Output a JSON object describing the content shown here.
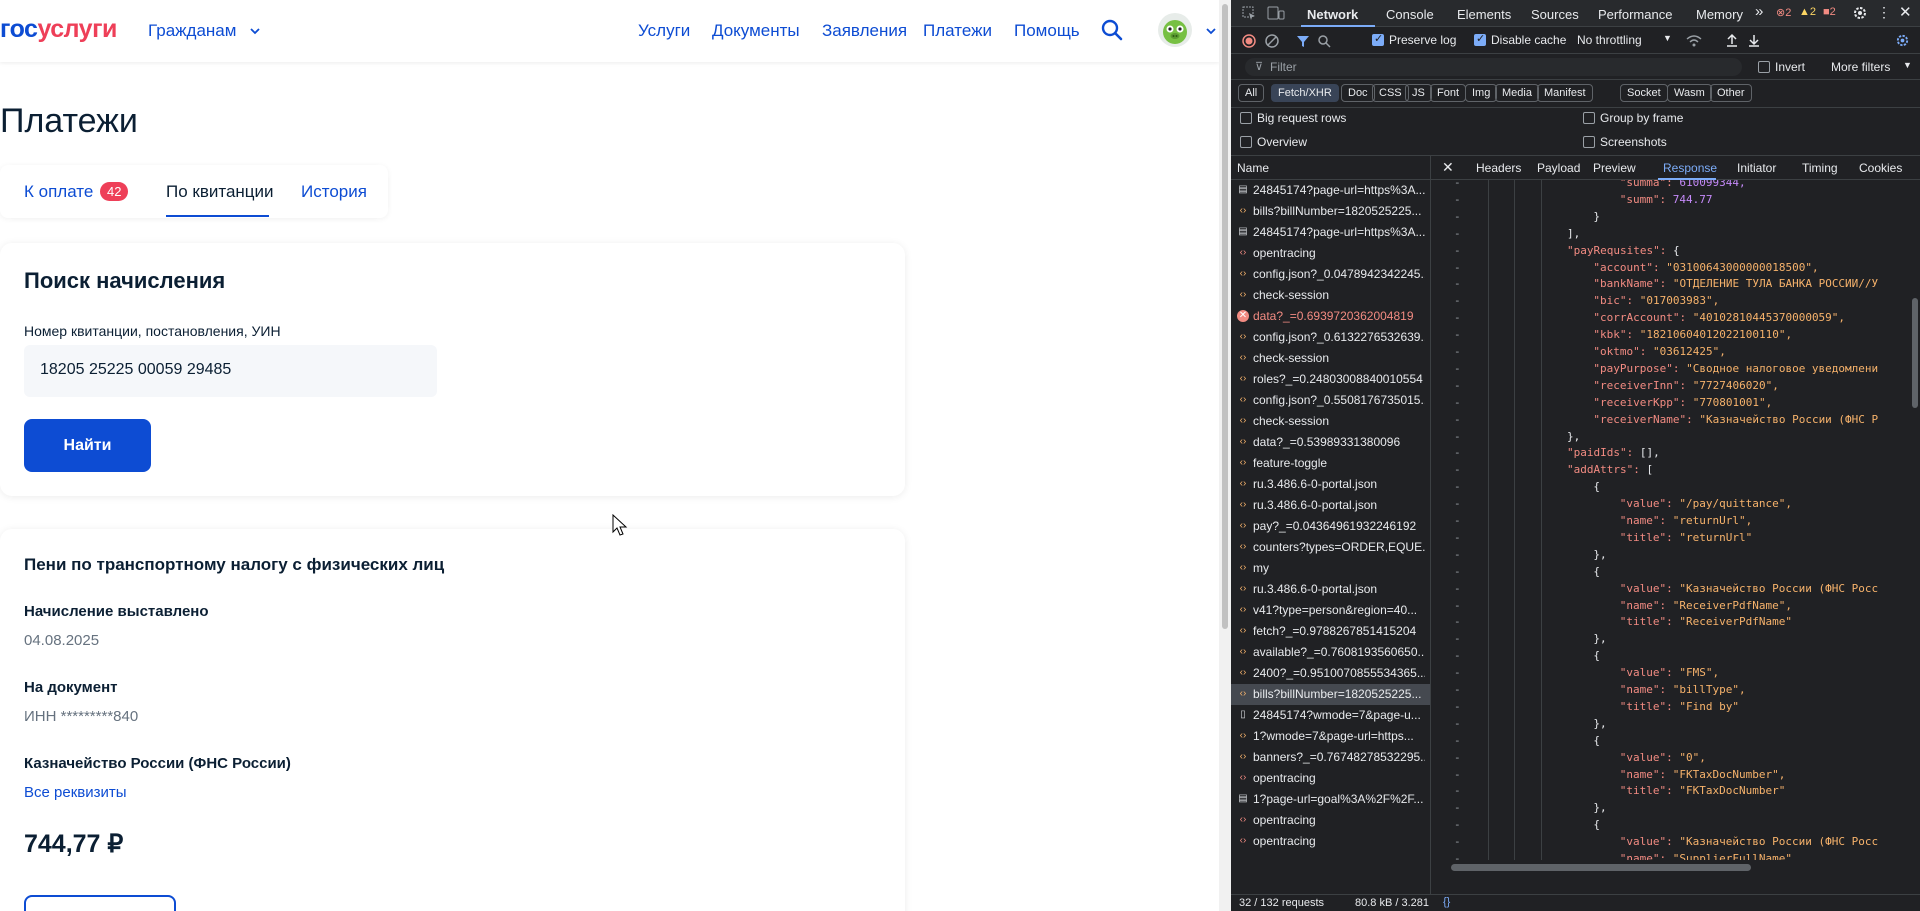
{
  "site": {
    "logo_part1": "гос",
    "logo_part2": "услуги",
    "citizen_menu": "Гражданам",
    "nav": [
      "Услуги",
      "Документы",
      "Заявления",
      "Платежи",
      "Помощь"
    ]
  },
  "page": {
    "title": "Платежи",
    "tabs": [
      {
        "label": "К оплате",
        "badge": "42"
      },
      {
        "label": "По квитанции"
      },
      {
        "label": "История"
      }
    ],
    "active_tab": "По квитанции"
  },
  "search_card": {
    "title": "Поиск начисления",
    "field_label": "Номер квитанции, постановления, УИН",
    "field_value": "18205 25225 00059 29485",
    "button": "Найти"
  },
  "charge_card": {
    "title": "Пени по транспортному налогу с физических лиц",
    "issued_label": "Начисление выставлено",
    "issued_value": "04.08.2025",
    "document_label": "На документ",
    "document_value": "ИНН *********840",
    "receiver": "Казначейство России (ФНС России)",
    "details_link": "Все реквизиты",
    "amount": "744,77 ₽"
  },
  "devtools": {
    "tabs": [
      "Network",
      "Console",
      "Elements",
      "Sources",
      "Performance",
      "Memory"
    ],
    "more_tabs": "»",
    "error_counts": [
      "2",
      "2",
      "2"
    ],
    "toolbar": {
      "preserve_log": "Preserve log",
      "disable_cache": "Disable cache",
      "throttling": "No throttling"
    },
    "filter_placeholder": "Filter",
    "invert": "Invert",
    "more_filters": "More filters",
    "type_filters": [
      "All",
      "Fetch/XHR",
      "Doc",
      "CSS",
      "JS",
      "Font",
      "Img",
      "Media",
      "Manifest",
      "Socket",
      "Wasm",
      "Other"
    ],
    "selected_type": "Fetch/XHR",
    "options": [
      "Big request rows",
      "Group by frame",
      "Overview",
      "Screenshots"
    ],
    "name_header": "Name",
    "requests": [
      {
        "name": "24845174?page-url=https%3A...",
        "icon": "doc"
      },
      {
        "name": "bills?billNumber=1820525225...",
        "icon": "xhr"
      },
      {
        "name": "24845174?page-url=https%3A...",
        "icon": "doc"
      },
      {
        "name": "opentracing",
        "icon": "fetch"
      },
      {
        "name": "config.json?_0.0478942342245...",
        "icon": "xhr"
      },
      {
        "name": "check-session",
        "icon": "xhr"
      },
      {
        "name": "data?_=0.6939720362004819",
        "icon": "error"
      },
      {
        "name": "config.json?_0.6132276532639...",
        "icon": "xhr"
      },
      {
        "name": "check-session",
        "icon": "xhr"
      },
      {
        "name": "roles?_=0.24803008840010554",
        "icon": "xhr"
      },
      {
        "name": "config.json?_0.5508176735015...",
        "icon": "xhr"
      },
      {
        "name": "check-session",
        "icon": "xhr"
      },
      {
        "name": "data?_=0.53989331380096",
        "icon": "xhr"
      },
      {
        "name": "feature-toggle",
        "icon": "xhr"
      },
      {
        "name": "ru.3.486.6-0-portal.json",
        "icon": "xhr"
      },
      {
        "name": "ru.3.486.6-0-portal.json",
        "icon": "xhr"
      },
      {
        "name": "pay?_=0.04364961932246192",
        "icon": "xhr"
      },
      {
        "name": "counters?types=ORDER,EQUE...",
        "icon": "xhr"
      },
      {
        "name": "my",
        "icon": "xhr"
      },
      {
        "name": "ru.3.486.6-0-portal.json",
        "icon": "xhr"
      },
      {
        "name": "v41?type=person&region=40...",
        "icon": "xhr"
      },
      {
        "name": "fetch?_=0.9788267851415204",
        "icon": "xhr"
      },
      {
        "name": "available?_=0.7608193560650...",
        "icon": "xhr"
      },
      {
        "name": "2400?_=0.9510070855534365...",
        "icon": "xhr"
      },
      {
        "name": "bills?billNumber=1820525225...",
        "icon": "xhr",
        "selected": true
      },
      {
        "name": "24845174?wmode=7&page-u...",
        "icon": "file"
      },
      {
        "name": "1?wmode=7&page-url=https...",
        "icon": "xhr"
      },
      {
        "name": "banners?_=0.76748278532295...",
        "icon": "xhr"
      },
      {
        "name": "opentracing",
        "icon": "fetch"
      },
      {
        "name": "1?page-url=goal%3A%2F%2F...",
        "icon": "doc"
      },
      {
        "name": "opentracing",
        "icon": "fetch"
      },
      {
        "name": "opentracing",
        "icon": "fetch"
      }
    ],
    "response_tabs": [
      "Headers",
      "Payload",
      "Preview",
      "Response",
      "Initiator",
      "Timing",
      "Cookies"
    ],
    "selected_response_tab": "Response",
    "response_lines": [
      {
        "indent": 20,
        "text": "\"summa\": 610099344,",
        "color": "kk"
      },
      {
        "indent": 20,
        "text": "\"summ\": 744.77",
        "color": "kk"
      },
      {
        "indent": 16,
        "text": "}",
        "color": ""
      },
      {
        "indent": 12,
        "text": "],",
        "color": ""
      },
      {
        "indent": 12,
        "text": "\"payRequsites\": {",
        "color": "kk"
      },
      {
        "indent": 16,
        "text": "\"account\": \"03100643000000018500\",",
        "color": "kk"
      },
      {
        "indent": 16,
        "text": "\"bankName\": \"ОТДЕЛЕНИЕ ТУЛА БАНКА РОССИИ//У",
        "color": "kk"
      },
      {
        "indent": 16,
        "text": "\"bic\": \"017003983\",",
        "color": "kk"
      },
      {
        "indent": 16,
        "text": "\"corrAccount\": \"40102810445370000059\",",
        "color": "kk"
      },
      {
        "indent": 16,
        "text": "\"kbk\": \"18210604012022100110\",",
        "color": "kk"
      },
      {
        "indent": 16,
        "text": "\"oktmo\": \"03612425\",",
        "color": "kk"
      },
      {
        "indent": 16,
        "text": "\"payPurpose\": \"Сводное налоговое уведомлени",
        "color": "kk"
      },
      {
        "indent": 16,
        "text": "\"receiverInn\": \"7727406020\",",
        "color": "kk"
      },
      {
        "indent": 16,
        "text": "\"receiverKpp\": \"770801001\",",
        "color": "kk"
      },
      {
        "indent": 16,
        "text": "\"receiverName\": \"Казначейство России (ФНС Р",
        "color": "kk"
      },
      {
        "indent": 12,
        "text": "},",
        "color": ""
      },
      {
        "indent": 12,
        "text": "\"paidIds\": [],",
        "color": "kk"
      },
      {
        "indent": 12,
        "text": "\"addAttrs\": [",
        "color": "kk"
      },
      {
        "indent": 16,
        "text": "{",
        "color": ""
      },
      {
        "indent": 20,
        "text": "\"value\": \"/pay/quittance\",",
        "color": "kk"
      },
      {
        "indent": 20,
        "text": "\"name\": \"returnUrl\",",
        "color": "kk"
      },
      {
        "indent": 20,
        "text": "\"title\": \"returnUrl\"",
        "color": "kk"
      },
      {
        "indent": 16,
        "text": "},",
        "color": ""
      },
      {
        "indent": 16,
        "text": "{",
        "color": ""
      },
      {
        "indent": 20,
        "text": "\"value\": \"Казначейство России (ФНС Росс",
        "color": "kk"
      },
      {
        "indent": 20,
        "text": "\"name\": \"ReceiverPdfName\",",
        "color": "kk"
      },
      {
        "indent": 20,
        "text": "\"title\": \"ReceiverPdfName\"",
        "color": "kk"
      },
      {
        "indent": 16,
        "text": "},",
        "color": ""
      },
      {
        "indent": 16,
        "text": "{",
        "color": ""
      },
      {
        "indent": 20,
        "text": "\"value\": \"FMS\",",
        "color": "kk"
      },
      {
        "indent": 20,
        "text": "\"name\": \"billType\",",
        "color": "kk"
      },
      {
        "indent": 20,
        "text": "\"title\": \"Find by\"",
        "color": "kk"
      },
      {
        "indent": 16,
        "text": "},",
        "color": ""
      },
      {
        "indent": 16,
        "text": "{",
        "color": ""
      },
      {
        "indent": 20,
        "text": "\"value\": \"0\",",
        "color": "kk"
      },
      {
        "indent": 20,
        "text": "\"name\": \"FKTaxDocNumber\",",
        "color": "kk"
      },
      {
        "indent": 20,
        "text": "\"title\": \"FKTaxDocNumber\"",
        "color": "kk"
      },
      {
        "indent": 16,
        "text": "},",
        "color": ""
      },
      {
        "indent": 16,
        "text": "{",
        "color": ""
      },
      {
        "indent": 20,
        "text": "\"value\": \"Казначейство России (ФНС Росс",
        "color": "kk"
      },
      {
        "indent": 20,
        "text": "\"name\": \"SupplierFullName\",",
        "color": "kk"
      },
      {
        "indent": 20,
        "text": "\"title\": \"SupplierFullName\"",
        "color": "kk"
      }
    ],
    "status_requests": "32 / 132 requests",
    "status_size": "80.8 kB / 3.281"
  }
}
